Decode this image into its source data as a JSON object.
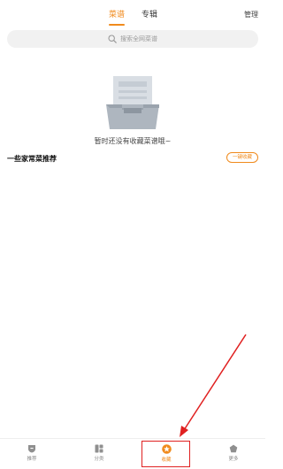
{
  "header": {
    "tabs": [
      {
        "label": "菜谱",
        "active": true
      },
      {
        "label": "专辑",
        "active": false
      }
    ],
    "manage_label": "管理"
  },
  "search": {
    "placeholder": "搜索全网菜谱"
  },
  "empty_state": {
    "message": "暂时还没有收藏菜谱哦~"
  },
  "recommend": {
    "title": "一些家常菜推荐",
    "action_label": "一键收藏"
  },
  "bottom_nav": [
    {
      "label": "推荐",
      "icon": "home-shield-icon",
      "active": false
    },
    {
      "label": "分类",
      "icon": "grid-icon",
      "active": false
    },
    {
      "label": "收藏",
      "icon": "star-icon",
      "active": true
    },
    {
      "label": "更多",
      "icon": "more-icon",
      "active": false
    }
  ],
  "colors": {
    "accent": "#f08a1c",
    "highlight": "#e02020"
  }
}
